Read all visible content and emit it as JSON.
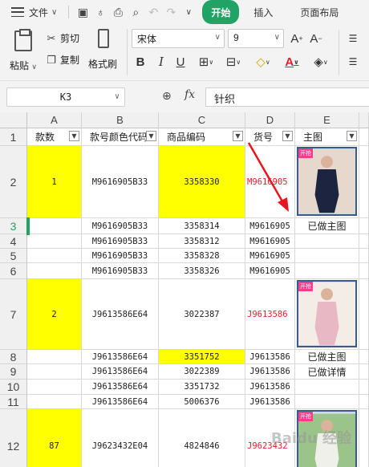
{
  "menubar": {
    "file_label": "文件",
    "tabs": [
      {
        "label": "开始",
        "active": true
      },
      {
        "label": "插入"
      },
      {
        "label": "页面布局"
      }
    ]
  },
  "toolbar": {
    "paste_label": "粘贴",
    "cut_label": "剪切",
    "copy_label": "复制",
    "format_painter_label": "格式刷",
    "font_name": "宋体",
    "font_size": "9"
  },
  "formula_bar": {
    "cell_ref": "K3",
    "fx_label": "fx",
    "content": "针织"
  },
  "columns": [
    "A",
    "B",
    "C",
    "D",
    "E"
  ],
  "headers": [
    "款数",
    "款号颜色代码",
    "商品编码",
    "货号",
    "主图"
  ],
  "rows": [
    {
      "num": "1",
      "a": "",
      "b": "",
      "c": "",
      "d": "",
      "e": ""
    },
    {
      "num": "2",
      "a": "1",
      "b": "M9616905B33",
      "c": "3358330",
      "d": "M9616905",
      "e": "image"
    },
    {
      "num": "3",
      "a": "",
      "b": "M9616905B33",
      "c": "3358314",
      "d": "M9616905",
      "e": "已做主图"
    },
    {
      "num": "4",
      "a": "",
      "b": "M9616905B33",
      "c": "3358312",
      "d": "M9616905",
      "e": ""
    },
    {
      "num": "5",
      "a": "",
      "b": "M9616905B33",
      "c": "3358328",
      "d": "M9616905",
      "e": ""
    },
    {
      "num": "6",
      "a": "",
      "b": "M9616905B33",
      "c": "3358326",
      "d": "M9616905",
      "e": ""
    },
    {
      "num": "7",
      "a": "2",
      "b": "J9613586E64",
      "c": "3022387",
      "d": "J9613586",
      "e": "image"
    },
    {
      "num": "8",
      "a": "",
      "b": "J9613586E64",
      "c": "3351752",
      "d": "J9613586",
      "e": "已做主图"
    },
    {
      "num": "9",
      "a": "",
      "b": "J9613586E64",
      "c": "3022389",
      "d": "J9613586",
      "e": "已做详情"
    },
    {
      "num": "10",
      "a": "",
      "b": "J9613586E64",
      "c": "3351732",
      "d": "J9613586",
      "e": ""
    },
    {
      "num": "11",
      "a": "",
      "b": "J9613586E64",
      "c": "5006376",
      "d": "J9613586",
      "e": ""
    },
    {
      "num": "12",
      "a": "87",
      "b": "J9623432E04",
      "c": "4824846",
      "d": "J9623432",
      "e": "image"
    }
  ],
  "thumbnail_tag": "开抢",
  "watermark": "Baidu 经验",
  "colors": {
    "accent": "#21a366",
    "highlight": "#ffff00",
    "red_text": "#e0202a",
    "annotation_arrow": "#e8141e"
  }
}
